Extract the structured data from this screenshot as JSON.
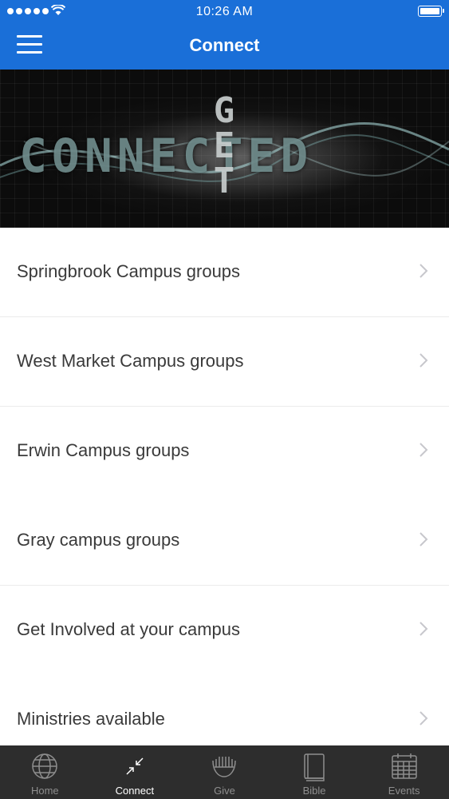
{
  "status_bar": {
    "time": "10:26 AM"
  },
  "header": {
    "title": "Connect"
  },
  "banner": {
    "word": "CONNECTED",
    "vertical_word": [
      "G",
      "E",
      "T"
    ]
  },
  "list": [
    {
      "label": "Springbrook Campus groups"
    },
    {
      "label": "West Market Campus groups"
    },
    {
      "label": "Erwin Campus groups"
    },
    {
      "label": "Gray campus groups"
    },
    {
      "label": "Get Involved at your campus"
    },
    {
      "label": "Ministries available"
    }
  ],
  "tabs": [
    {
      "label": "Home",
      "icon": "globe-icon"
    },
    {
      "label": "Connect",
      "icon": "arrows-inward-icon",
      "active": true
    },
    {
      "label": "Give",
      "icon": "hands-icon"
    },
    {
      "label": "Bible",
      "icon": "book-icon"
    },
    {
      "label": "Events",
      "icon": "calendar-icon"
    }
  ],
  "colors": {
    "nav_bar": "#1a6fd8",
    "tab_bar": "#2d2d2d",
    "text": "#3a3a3a",
    "tab_inactive": "#8e8e8e"
  }
}
